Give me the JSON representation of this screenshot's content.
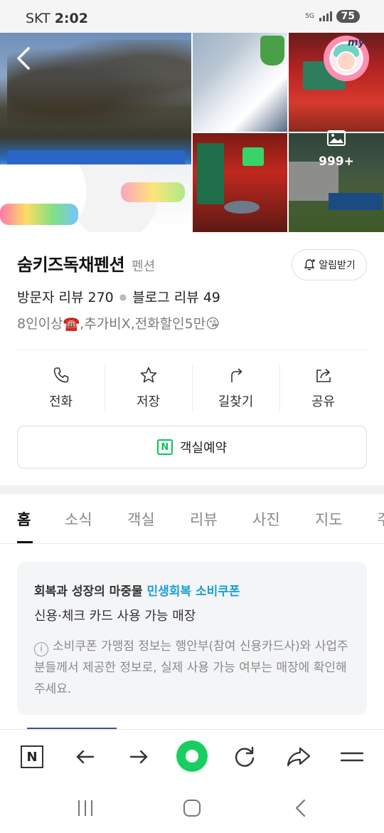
{
  "status_bar": {
    "carrier": "SKT",
    "time": "2:02",
    "network": "5G",
    "battery": "75"
  },
  "photos": {
    "more_count": "999+",
    "profile_badge_text": "my"
  },
  "place": {
    "name": "숨키즈독채펜션",
    "category": "펜션",
    "alert_button": "알림받기",
    "visitor_reviews": "방문자 리뷰 270",
    "blog_reviews": "블로그 리뷰 49",
    "description": "8인이상☎️,추가비X,전화할인5만😘"
  },
  "actions": [
    {
      "label": "전화",
      "icon": "phone-icon"
    },
    {
      "label": "저장",
      "icon": "star-icon"
    },
    {
      "label": "길찾기",
      "icon": "directions-icon"
    },
    {
      "label": "공유",
      "icon": "share-icon"
    }
  ],
  "reserve": {
    "label": "객실예약",
    "icon_text": "N",
    "accent": "#03c75a"
  },
  "tabs": [
    "홈",
    "소식",
    "객실",
    "리뷰",
    "사진",
    "지도",
    "주"
  ],
  "coupon": {
    "title_prefix": "회복과 성장의 마중물 ",
    "title_highlight": "민생회복 소비쿠폰",
    "subtitle": "신용·체크 카드 사용 가능 매장",
    "note": "소비쿠폰 가맹점 정보는 행안부(참여 신용카드사)와 사업주분들께서 제공한 정보로, 실제 사용 가능 여부는 매장에 확인해 주세요.",
    "info_icon_text": "i",
    "highlight_color": "#1a9fd6"
  },
  "browser_bar": {
    "home_label": "N",
    "accent": "#19ce60"
  }
}
